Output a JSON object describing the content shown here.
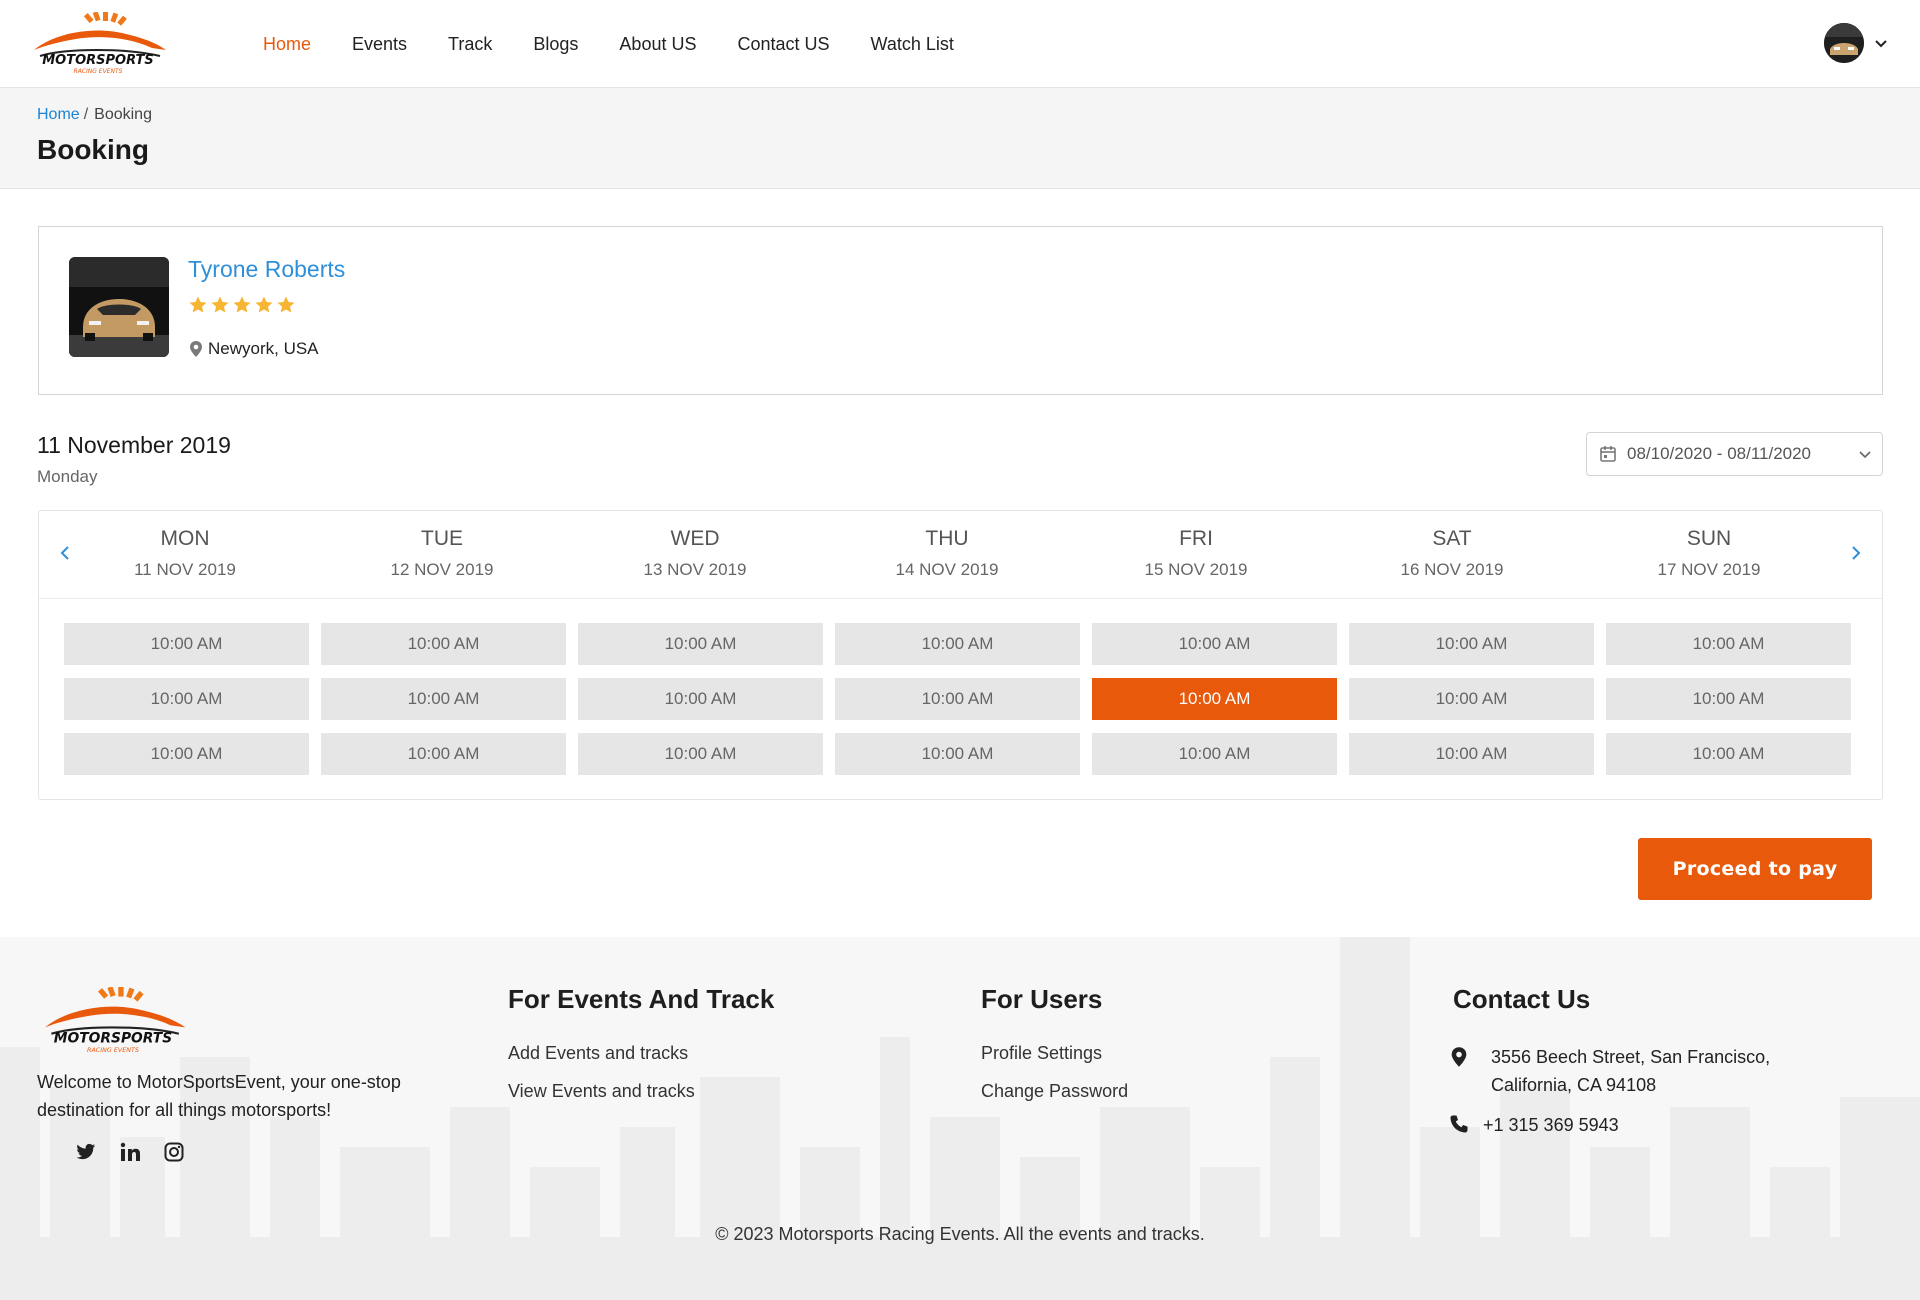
{
  "header": {
    "brand_main": "MOTORSPORTS",
    "brand_sub": "RACING EVENTS",
    "nav": [
      "Home",
      "Events",
      "Track",
      "Blogs",
      "About US",
      "Contact US",
      "Watch List"
    ]
  },
  "banner": {
    "breadcrumb": [
      "Home",
      "Booking"
    ],
    "title": "Booking"
  },
  "profile": {
    "name": "Tyrone Roberts",
    "rating": 5,
    "rating_max": 5,
    "location": "Newyork, USA"
  },
  "date_header": {
    "date": "11 November 2019",
    "weekday": "Monday",
    "range": "08/10/2020 - 08/11/2020"
  },
  "schedule": {
    "days": [
      {
        "name": "MON",
        "date": "11 NOV 2019",
        "slots": [
          "10:00 AM",
          "10:00 AM",
          "10:00 AM"
        ]
      },
      {
        "name": "TUE",
        "date": "12 NOV 2019",
        "slots": [
          "10:00 AM",
          "10:00 AM",
          "10:00 AM"
        ]
      },
      {
        "name": "WED",
        "date": "13 NOV 2019",
        "slots": [
          "10:00 AM",
          "10:00 AM",
          "10:00 AM"
        ]
      },
      {
        "name": "THU",
        "date": "14 NOV 2019",
        "slots": [
          "10:00 AM",
          "10:00 AM",
          "10:00 AM"
        ]
      },
      {
        "name": "FRI",
        "date": "15 NOV 2019",
        "slots": [
          "10:00 AM",
          "10:00 AM",
          "10:00 AM"
        ]
      },
      {
        "name": "SAT",
        "date": "16 NOV 2019",
        "slots": [
          "10:00 AM",
          "10:00 AM",
          "10:00 AM"
        ]
      },
      {
        "name": "SUN",
        "date": "17 NOV 2019",
        "slots": [
          "10:00 AM",
          "10:00 AM",
          "10:00 AM"
        ]
      }
    ],
    "selected": {
      "day": "FRI",
      "slot_index": 1
    }
  },
  "proceed_label": "Proceed to pay",
  "footer": {
    "about": "Welcome to MotorSportsEvent, your one-stop destination for all things motorsports!",
    "socials": [
      "twitter-icon",
      "linkedin-icon",
      "instagram-icon"
    ],
    "events_title": "For Events And Track",
    "events_links": [
      "Add Events and tracks",
      "View Events and tracks"
    ],
    "users_title": "For Users",
    "users_links": [
      "Profile Settings",
      "Change Password"
    ],
    "contact_title": "Contact Us",
    "address_line1": "3556 Beech Street, San Francisco,",
    "address_line2": "California, CA 94108",
    "phone": "+1 315 369 5943",
    "copyright": "© 2023 Motorsports Racing Events. All the events and tracks."
  },
  "colors": {
    "accent": "#e8590c",
    "link": "#2f8fd8",
    "star": "#f6b532",
    "slot": "#e6e6e6"
  }
}
